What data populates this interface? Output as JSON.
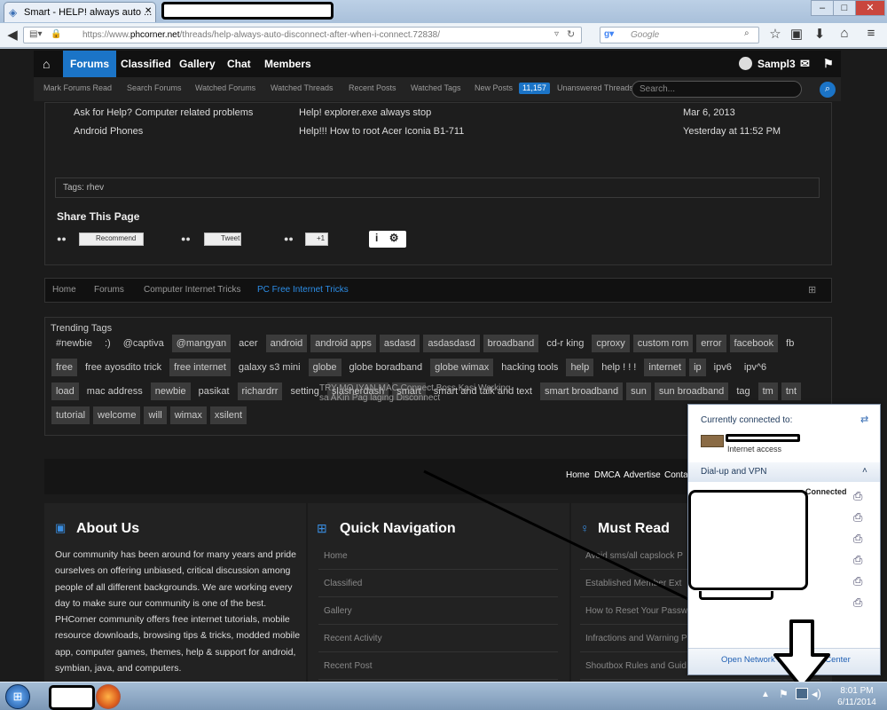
{
  "browser": {
    "tab_title": "Smart - HELP! always auto ...",
    "url_prefix": "https://www.",
    "url_domain": "phcorner.net",
    "url_path": "/threads/help-always-auto-disconnect-after-when-i-connect.72838/",
    "search_engine_label": "Google",
    "window_minimize": "–",
    "window_maximize": "□",
    "window_close": "✕"
  },
  "site": {
    "nav": [
      "Forums",
      "Classified",
      "Gallery",
      "Chat",
      "Members"
    ],
    "username": "Sampl3",
    "subnav": [
      "Mark Forums Read",
      "Search Forums",
      "Watched Forums",
      "Watched Threads",
      "Recent Posts",
      "Watched Tags",
      "New Posts"
    ],
    "new_posts_count": "11,157",
    "unanswered": "Unanswered Threads",
    "search_placeholder": "Search..."
  },
  "similar_threads": [
    {
      "forum": "Ask for Help? Computer related problems",
      "title": "Help! explorer.exe always stop",
      "date": "Mar 6, 2013"
    },
    {
      "forum": "Android Phones",
      "title": "Help!!! How to root Acer Iconia B1-711",
      "date": "Yesterday at 11:52 PM"
    }
  ],
  "tags_line": "Tags: rhev",
  "share": {
    "heading": "Share This Page",
    "recommend": "Recommend",
    "tweet": "Tweet",
    "plus": "+1",
    "info": "i",
    "gear": "⚙"
  },
  "breadcrumb": [
    "Home",
    "Forums",
    "Computer Internet Tricks",
    "PC Free Internet Tricks"
  ],
  "trending": {
    "title": "Trending Tags",
    "rows": [
      [
        {
          "t": "#newbie",
          "bg": false
        },
        {
          "t": ":)",
          "bg": false
        },
        {
          "t": "@captiva",
          "bg": false
        },
        {
          "t": "@mangyan",
          "bg": true
        },
        {
          "t": "acer",
          "bg": false
        },
        {
          "t": "android",
          "bg": true
        },
        {
          "t": "android apps",
          "bg": true
        },
        {
          "t": "asdasd",
          "bg": true
        },
        {
          "t": "asdasdasd",
          "bg": true
        },
        {
          "t": "broadband",
          "bg": true
        },
        {
          "t": "cd-r king",
          "bg": false
        },
        {
          "t": "cproxy",
          "bg": true
        },
        {
          "t": "custom rom",
          "bg": true
        },
        {
          "t": "error",
          "bg": true
        },
        {
          "t": "facebook",
          "bg": true
        },
        {
          "t": "fb",
          "bg": false
        }
      ],
      [
        {
          "t": "free",
          "bg": true
        },
        {
          "t": "free ayosdito trick",
          "bg": false
        },
        {
          "t": "free internet",
          "bg": true
        },
        {
          "t": "galaxy s3 mini",
          "bg": false
        },
        {
          "t": "globe",
          "bg": true
        },
        {
          "t": "globe boradband",
          "bg": false
        },
        {
          "t": "globe wimax",
          "bg": true
        },
        {
          "t": "hacking tools",
          "bg": false
        },
        {
          "t": "help",
          "bg": true
        },
        {
          "t": "help ! ! !",
          "bg": false
        },
        {
          "t": "internet",
          "bg": true
        },
        {
          "t": "ip",
          "bg": true
        },
        {
          "t": "ipv6",
          "bg": false
        },
        {
          "t": "ipv^6",
          "bg": false
        }
      ],
      [
        {
          "t": "load",
          "bg": true
        },
        {
          "t": "mac address",
          "bg": false
        },
        {
          "t": "newbie",
          "bg": true
        },
        {
          "t": "pasikat",
          "bg": false
        },
        {
          "t": "richardrr",
          "bg": true
        },
        {
          "t": "setting",
          "bg": false
        },
        {
          "t": "slasherdash",
          "bg": true
        },
        {
          "t": "smart",
          "bg": true
        },
        {
          "t": "smart and talk and text",
          "bg": false
        },
        {
          "t": "smart broadband",
          "bg": true
        },
        {
          "t": "sun",
          "bg": true
        },
        {
          "t": "sun broadband",
          "bg": true
        },
        {
          "t": "tag",
          "bg": false
        },
        {
          "t": "tm",
          "bg": true
        },
        {
          "t": "tnt",
          "bg": true
        }
      ],
      [
        {
          "t": "tutorial",
          "bg": true
        },
        {
          "t": "welcome",
          "bg": true
        },
        {
          "t": "will",
          "bg": true
        },
        {
          "t": "wimax",
          "bg": true
        },
        {
          "t": "xsilent",
          "bg": true
        }
      ]
    ],
    "tooltip_line1": "TRY MO IYAN MAC Connect Boss Kasi Working",
    "tooltip_line2": "sa AKin Pag laging Disconnect"
  },
  "footer_nav": [
    "Home",
    "DMCA",
    "Advertise",
    "Conta"
  ],
  "about": {
    "title": "About Us",
    "lines": [
      "Our community has been around for many years and pride",
      "ourselves on offering unbiased, critical discussion among",
      "people of all different backgrounds. We are working every",
      "day to make sure our community is one of the best.",
      "PHCorner community offers free internet tutorials, mobile",
      "resource downloads, browsing tips & tricks, modded mobile",
      "app, computer games, themes, help & support for android,",
      "symbian, java, and computers."
    ]
  },
  "quick_nav": {
    "title": "Quick Navigation",
    "links": [
      "Home",
      "Classified",
      "Gallery",
      "Recent Activity",
      "Recent Post"
    ]
  },
  "must_read": {
    "title": "Must Read",
    "links": [
      "Avoid sms/all capslock P",
      "Established Member Ext",
      "How to Reset Your Passw",
      "Infractions and Warning P",
      "Shoutbox Rules and Guid"
    ]
  },
  "network_popup": {
    "heading": "Currently connected to:",
    "access": "Internet access",
    "dialup": "Dial-up and VPN",
    "connected": "Connected",
    "open_center": "Open Network and Sharing Center"
  },
  "taskbar": {
    "time": "8:01 PM",
    "date": "6/11/2014"
  }
}
